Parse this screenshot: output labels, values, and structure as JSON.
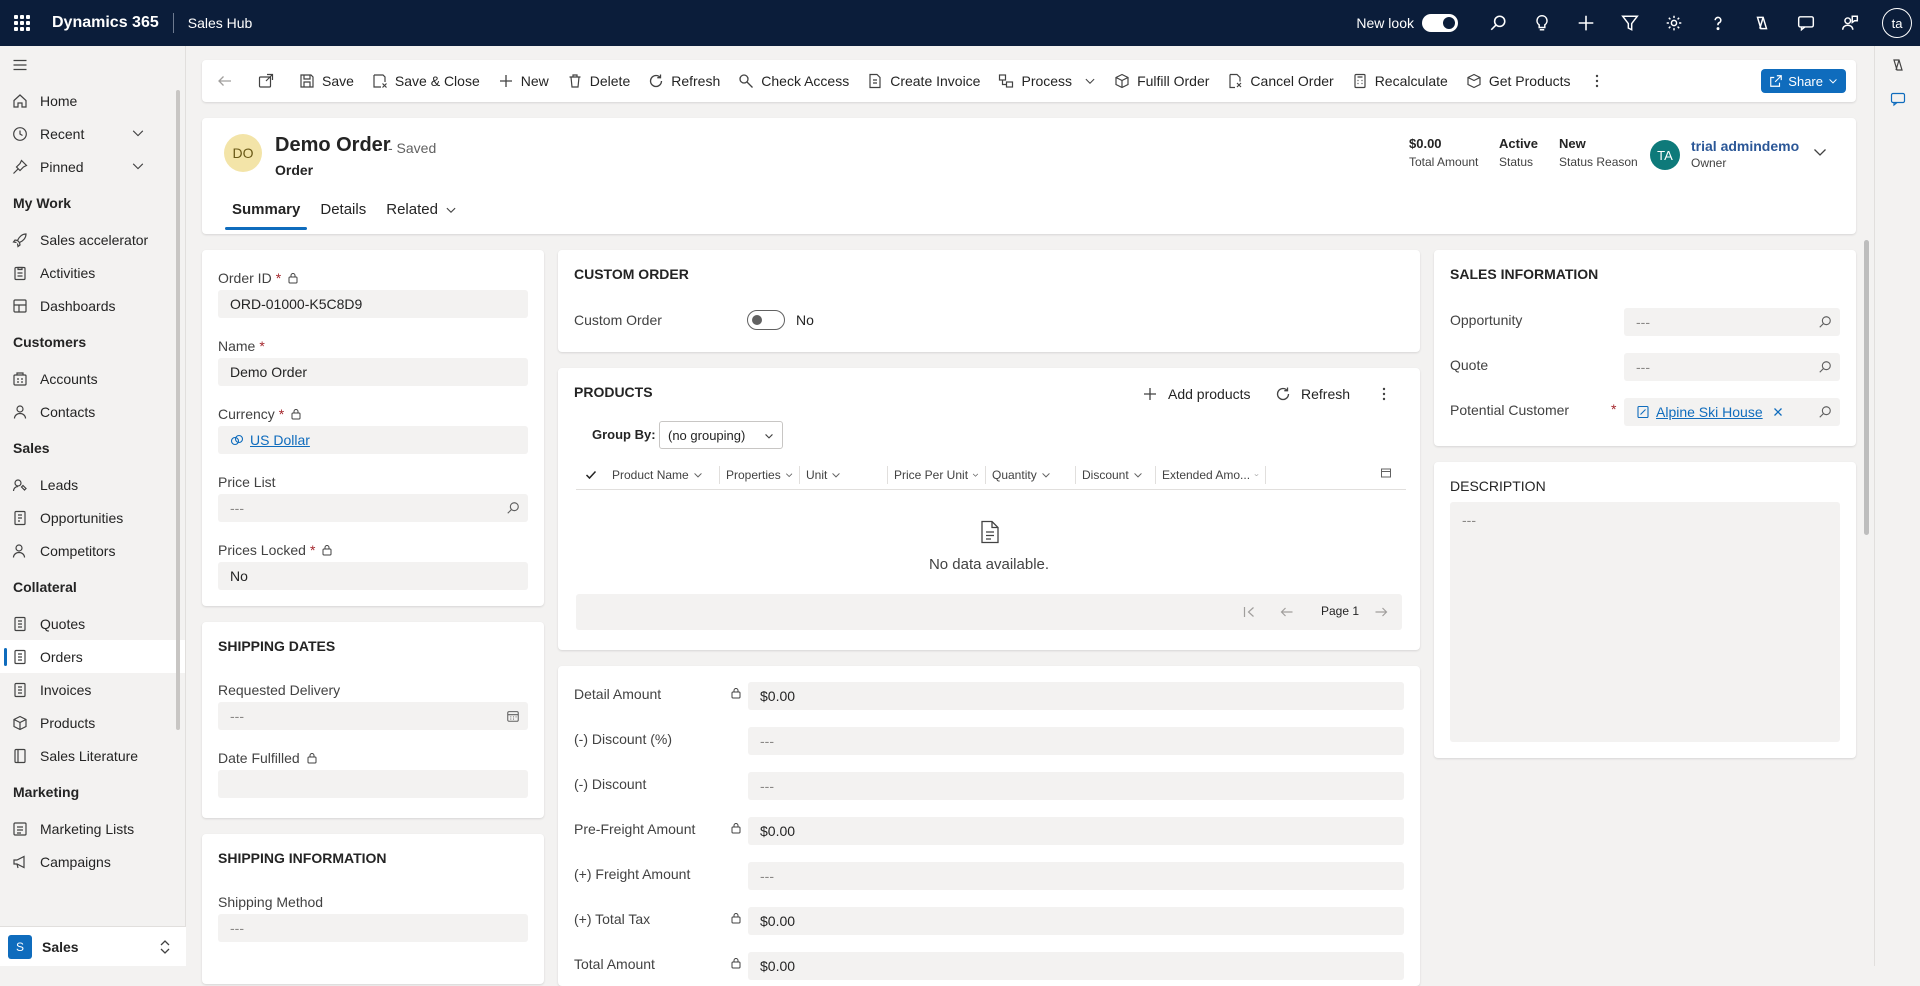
{
  "topbar": {
    "app_name": "Dynamics 365",
    "area_name": "Sales Hub",
    "new_look_label": "New look",
    "user_initials": "ta"
  },
  "sidebar": {
    "items_top": [
      {
        "label": "Home"
      },
      {
        "label": "Recent"
      },
      {
        "label": "Pinned"
      }
    ],
    "groups": [
      {
        "title": "My Work",
        "items": [
          "Sales accelerator",
          "Activities",
          "Dashboards"
        ]
      },
      {
        "title": "Customers",
        "items": [
          "Accounts",
          "Contacts"
        ]
      },
      {
        "title": "Sales",
        "items": [
          "Leads",
          "Opportunities",
          "Competitors"
        ]
      },
      {
        "title": "Collateral",
        "items": [
          "Quotes",
          "Orders",
          "Invoices",
          "Products",
          "Sales Literature"
        ]
      },
      {
        "title": "Marketing",
        "items": [
          "Marketing Lists",
          "Campaigns"
        ]
      }
    ],
    "area_switcher": {
      "initial": "S",
      "label": "Sales"
    }
  },
  "commands": {
    "save": "Save",
    "save_close": "Save & Close",
    "new": "New",
    "delete": "Delete",
    "refresh": "Refresh",
    "check_access": "Check Access",
    "create_invoice": "Create Invoice",
    "process": "Process",
    "fulfill_order": "Fulfill Order",
    "cancel_order": "Cancel Order",
    "recalculate": "Recalculate",
    "get_products": "Get Products",
    "share": "Share"
  },
  "header": {
    "initials": "DO",
    "title": "Demo Order",
    "saved_state": "- Saved",
    "entity": "Order",
    "total_amount_value": "$0.00",
    "total_amount_label": "Total Amount",
    "status_value": "Active",
    "status_label": "Status",
    "status_reason_value": "New",
    "status_reason_label": "Status Reason",
    "owner_initials": "TA",
    "owner_name": "trial admindemo",
    "owner_label": "Owner"
  },
  "tabs": [
    "Summary",
    "Details",
    "Related"
  ],
  "general": {
    "order_id_label": "Order ID",
    "order_id_value": "ORD-01000-K5C8D9",
    "name_label": "Name",
    "name_value": "Demo Order",
    "currency_label": "Currency",
    "currency_value": "US Dollar",
    "price_list_label": "Price List",
    "price_list_value": "---",
    "prices_locked_label": "Prices Locked",
    "prices_locked_value": "No",
    "required_mark": "*"
  },
  "shipping_dates": {
    "title": "SHIPPING DATES",
    "requested_delivery_label": "Requested Delivery",
    "requested_delivery_value": "---",
    "date_fulfilled_label": "Date Fulfilled"
  },
  "shipping_info": {
    "title": "SHIPPING INFORMATION",
    "shipping_method_label": "Shipping Method",
    "shipping_method_value": "---"
  },
  "custom_order": {
    "title": "CUSTOM ORDER",
    "label": "Custom Order",
    "value": "No"
  },
  "products": {
    "title": "PRODUCTS",
    "add_products": "Add products",
    "refresh": "Refresh",
    "group_by_label": "Group By:",
    "group_by_value": "(no grouping)",
    "columns": [
      "Product Name",
      "Properties",
      "Unit",
      "Price Per Unit",
      "Quantity",
      "Discount",
      "Extended Amo..."
    ],
    "empty_message": "No data available.",
    "page_label": "Page 1"
  },
  "totals": [
    {
      "label": "Detail Amount",
      "value": "$0.00",
      "locked": true
    },
    {
      "label": "(-) Discount (%)",
      "value": "---",
      "locked": false
    },
    {
      "label": "(-) Discount",
      "value": "---",
      "locked": false
    },
    {
      "label": "Pre-Freight Amount",
      "value": "$0.00",
      "locked": true
    },
    {
      "label": "(+) Freight Amount",
      "value": "---",
      "locked": false
    },
    {
      "label": "(+) Total Tax",
      "value": "$0.00",
      "locked": true
    },
    {
      "label": "Total Amount",
      "value": "$0.00",
      "locked": true
    }
  ],
  "sales_info": {
    "title": "SALES INFORMATION",
    "opportunity_label": "Opportunity",
    "opportunity_value": "---",
    "quote_label": "Quote",
    "quote_value": "---",
    "potential_customer_label": "Potential Customer",
    "potential_customer_value": "Alpine Ski House"
  },
  "description": {
    "title": "DESCRIPTION",
    "value": "---"
  },
  "colors": {
    "topbar": "#0b1d3a",
    "accent": "#0f6cbd"
  }
}
